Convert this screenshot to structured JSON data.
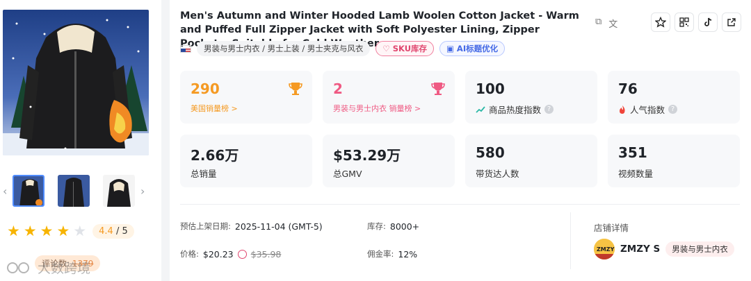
{
  "product": {
    "title": "Men's Autumn and Winter Hooded Lamb Woolen Cotton Jacket - Warm and Puffed Full Zipper Jacket with Soft Polyester Lining, Zipper Pockets, Suitable for Cold Weather -...",
    "category_path": "男装与男士内衣 / 男士上装 / 男士夹克与风衣",
    "sku_tag": "SKU库存",
    "ai_tag": "AI标题优化"
  },
  "icons": {
    "copy": "copy-icon",
    "translate": "translate-icon",
    "favorite": "star-outline-icon",
    "qrcode": "qrcode-icon",
    "tiktok": "tiktok-icon",
    "external": "external-link-icon"
  },
  "stats": [
    {
      "value": "290",
      "label": "美国销量榜 >",
      "color": "#f59a23",
      "icon": "trophy-icon"
    },
    {
      "value": "2",
      "label": "男装与男士内衣 销量榜 >",
      "color": "#ef5a83",
      "icon": "trophy-icon"
    },
    {
      "value": "100",
      "label": "商品热度指数",
      "icon": "trend-icon"
    },
    {
      "value": "76",
      "label": "人气指数",
      "icon": "fire-icon"
    },
    {
      "value": "2.66万",
      "label": "总销量"
    },
    {
      "value": "$53.29万",
      "label": "总GMV"
    },
    {
      "value": "580",
      "label": "带货达人数"
    },
    {
      "value": "351",
      "label": "视频数量"
    }
  ],
  "details": {
    "listing_date_label": "预估上架日期:",
    "listing_date": "2025-11-04 (GMT-5)",
    "stock_label": "库存:",
    "stock": "8000+",
    "price_label": "价格:",
    "price": "$20.23",
    "original_price": "$35.98",
    "commission_label": "佣金率:",
    "commission": "12%"
  },
  "store": {
    "section_title": "店铺详情",
    "name": "ZMZY S",
    "category": "男装与男士内衣"
  },
  "rating": {
    "score": "4.4",
    "max": "/ 5",
    "stars_filled": 4,
    "reviews_label": "评论数:",
    "reviews_count": "1379"
  },
  "watermark": "大数跨境"
}
